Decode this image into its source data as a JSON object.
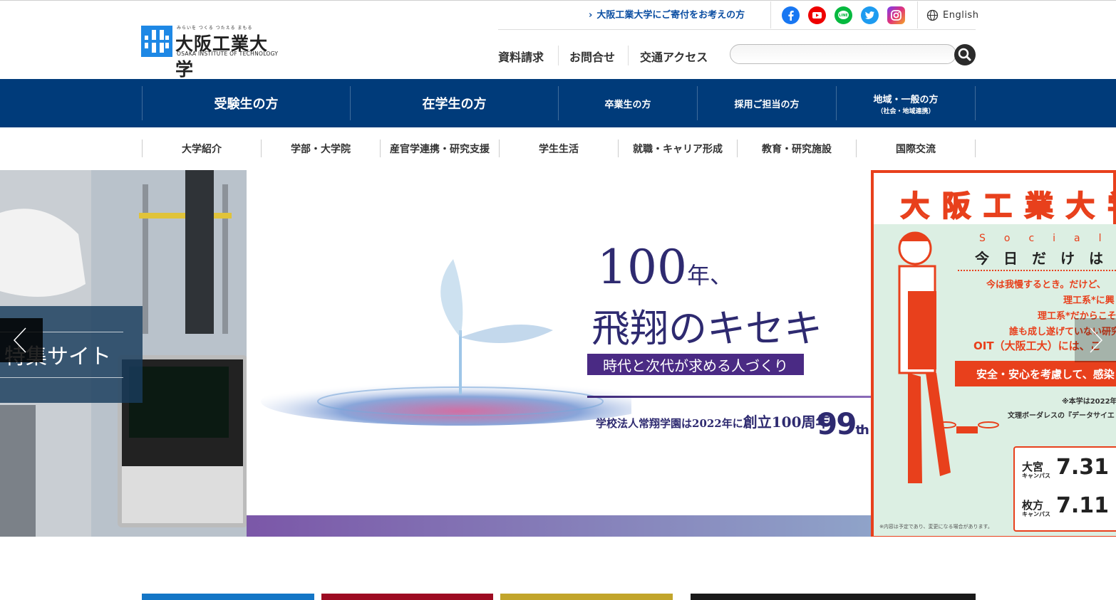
{
  "header": {
    "logo_tagline": "みらいを つくる つたえる まもる",
    "logo_name": "大阪工業大学",
    "logo_english": "OSAKA INSTITUTE OF TECHNOLOGY",
    "donate_link": "大阪工業大学にご寄付をお考えの方",
    "social": [
      "facebook-icon",
      "youtube-icon",
      "line-icon",
      "twitter-icon",
      "instagram-icon"
    ],
    "language": "English",
    "utility_links": [
      "資料請求",
      "お問合せ",
      "交通アクセス"
    ],
    "search_placeholder": ""
  },
  "nav_primary": [
    {
      "label": "受験生の方",
      "sub": ""
    },
    {
      "label": "在学生の方",
      "sub": ""
    },
    {
      "label": "卒業生の方",
      "sub": ""
    },
    {
      "label": "採用ご担当の方",
      "sub": ""
    },
    {
      "label": "地域・一般の方",
      "sub": "（社会・地域連携）"
    }
  ],
  "nav_secondary": [
    "大学紹介",
    "学部・大学院",
    "産官学連携・研究支援",
    "学生生活",
    "就職・キャリア形成",
    "教育・研究施設",
    "国際交流"
  ],
  "hero": {
    "left_slide_text": "特集サイト",
    "main_heading_num": "100",
    "main_heading_suffix": "年、",
    "main_heading_2": "飛翔のキセキ",
    "main_tagline": "時代と次代が求める人づくり",
    "founding_text_pre": "学校法人常翔学園は2022年に",
    "founding_text_big": "創立100周年",
    "anniversary": "99",
    "anniversary_suffix": "th",
    "right_slide": {
      "title": "大阪工業大学",
      "social_word": "Social",
      "today": "今日だけは",
      "lines": [
        "今は我慢するとき。だけど、",
        "理工系*に興",
        "理工系*だからこそ",
        "誰も成し遂げていない研究",
        "OIT（大阪工大）には、こ"
      ],
      "band": "安全・安心を考慮して、感染",
      "note1": "※本学は2022年",
      "note2": "文理ボーダレスの『データサイエ",
      "campus1": "大宮",
      "campus1_sub": "キャンパス",
      "date1": "7.31",
      "campus2": "枚方",
      "campus2_sub": "キャンパス",
      "date2": "7.11",
      "footnote": "※内容は予定であり、変更になる場合があります。"
    }
  },
  "colors": {
    "brand_blue": "#003b7a",
    "link_blue": "#0b4ea2",
    "bar1": "#1476c6",
    "bar2": "#9d0b22",
    "bar3": "#c2a52b",
    "bar4": "#1a1a1a"
  }
}
